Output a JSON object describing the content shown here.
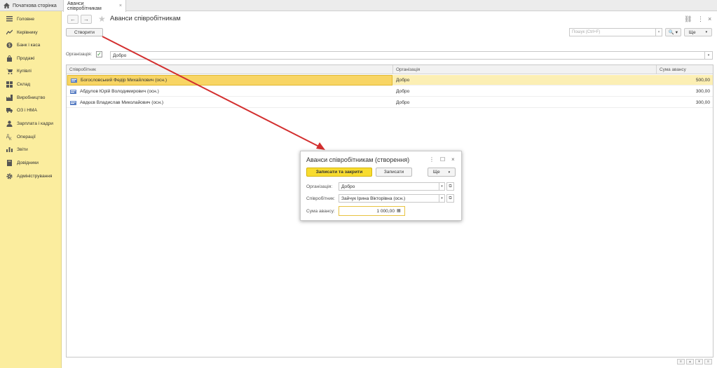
{
  "tabs": {
    "home": "Початкова сторінка",
    "active": "Аванси співробітникам",
    "close": "×"
  },
  "sidebar": {
    "items": [
      {
        "label": "Головне",
        "icon": "menu-lines-icon"
      },
      {
        "label": "Керівнику",
        "icon": "trend-chart-icon"
      },
      {
        "label": "Банк і каса",
        "icon": "coin-icon"
      },
      {
        "label": "Продажі",
        "icon": "shopping-bag-icon"
      },
      {
        "label": "Купівлі",
        "icon": "cart-icon"
      },
      {
        "label": "Склад",
        "icon": "warehouse-grid-icon"
      },
      {
        "label": "Виробництво",
        "icon": "factory-icon"
      },
      {
        "label": "ОЗ і НМА",
        "icon": "truck-icon"
      },
      {
        "label": "Зарплата і кадри",
        "icon": "person-icon"
      },
      {
        "label": "Операції",
        "icon": "operations-icon"
      },
      {
        "label": "Звіти",
        "icon": "bar-chart-icon"
      },
      {
        "label": "Довідники",
        "icon": "book-icon"
      },
      {
        "label": "Адміністрування",
        "icon": "gear-icon"
      }
    ]
  },
  "header": {
    "back": "←",
    "forward": "→",
    "star": "★",
    "title": "Аванси співробітникам",
    "link_icon": "⛓",
    "more_icon": "⋮",
    "close_icon": "×"
  },
  "toolbar": {
    "create": "Створити",
    "search_placeholder": "Пошук (Ctrl+F)",
    "search_dd": "×",
    "search_btn": "🔍 ▾",
    "more": "Ще",
    "more_dd": "▾"
  },
  "filter": {
    "label": "Організація:",
    "checked": "✓",
    "value": "Добро",
    "dd": "▾"
  },
  "table": {
    "columns": [
      "Співробітник",
      "Організація",
      "Сума авансу"
    ],
    "rows": [
      {
        "employee": "Богословський Федір Михайлович (осн.)",
        "org": "Добро",
        "amount": "500,00"
      },
      {
        "employee": "Абдулов Юрій Володимирович (осн.)",
        "org": "Добро",
        "amount": "300,00"
      },
      {
        "employee": "Авдєєв Владислав Миколайович (осн.)",
        "org": "Добро",
        "amount": "300,00"
      }
    ],
    "footer": [
      "≡",
      "▴",
      "▾",
      "≡"
    ]
  },
  "dialog": {
    "title": "Аванси співробітникам (створення)",
    "more_icon": "⋮",
    "max_icon": "☐",
    "close_icon": "×",
    "save_close": "Записати та закрити",
    "save": "Записати",
    "more": "Ще",
    "more_dd": "▾",
    "org_label": "Організація:",
    "org_value": "Добро",
    "emp_label": "Співробітник:",
    "emp_value": "Зайчук Ірина Вікторівна (осн.)",
    "amount_label": "Сума авансу:",
    "amount_value": "1 000,00",
    "dd": "▾",
    "link": "⧉",
    "calc": "▦"
  },
  "colors": {
    "sidebar_bg": "#fbed9e",
    "selected_row": "#fcefb4",
    "primary_button": "#f8dc2f",
    "arrow": "#d32f2f"
  }
}
